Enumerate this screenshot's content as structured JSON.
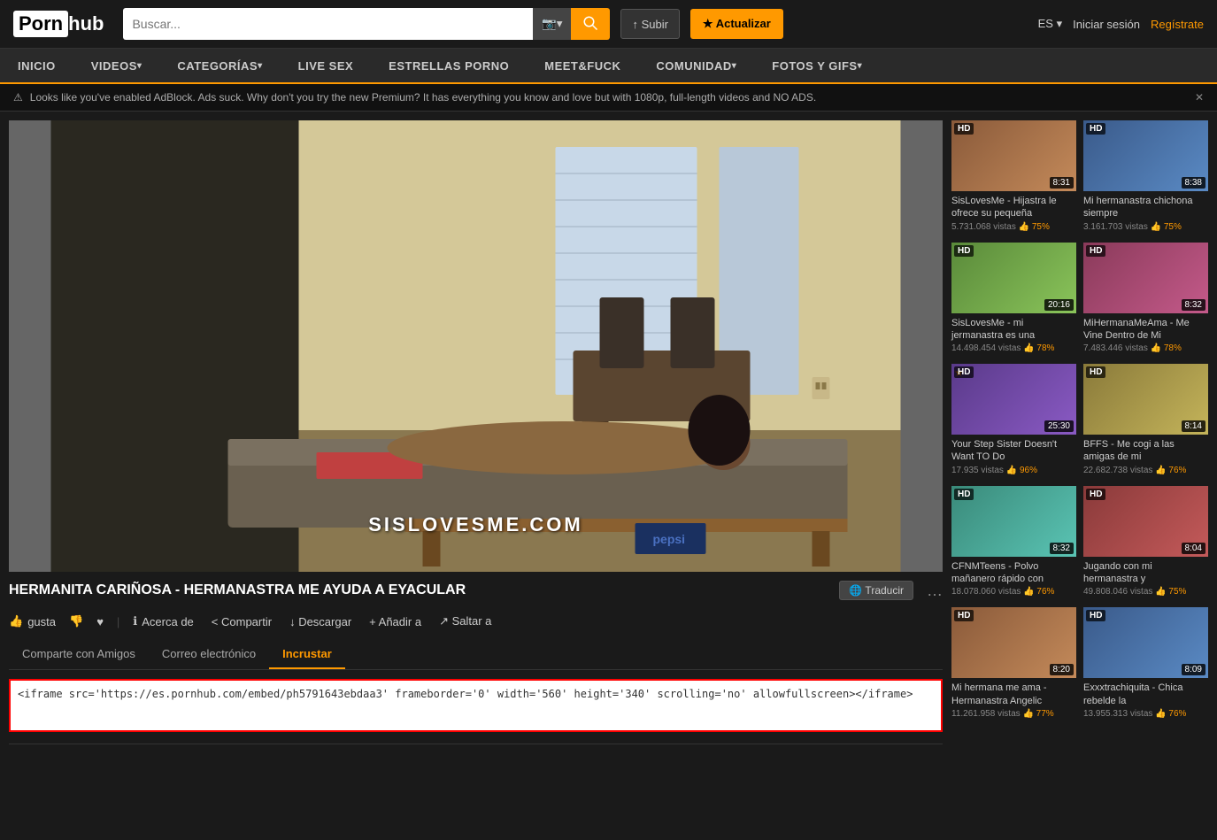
{
  "header": {
    "logo_black": "Porn",
    "logo_orange": "hub",
    "search_placeholder": "Buscar...",
    "upload_label": "↑ Subir",
    "premium_label": "★ Actualizar",
    "lang": "ES",
    "lang_arrow": "▾",
    "signin": "Iniciar sesión",
    "register": "Regístrate"
  },
  "nav": {
    "items": [
      {
        "label": "INICIO",
        "arrow": false
      },
      {
        "label": "VIDEOS",
        "arrow": true
      },
      {
        "label": "CATEGORÍAS",
        "arrow": true
      },
      {
        "label": "LIVE SEX",
        "arrow": false
      },
      {
        "label": "ESTRELLAS PORNO",
        "arrow": false
      },
      {
        "label": "MEET&FUCK",
        "arrow": false
      },
      {
        "label": "COMUNIDAD",
        "arrow": true
      },
      {
        "label": "FOTOS Y GIFS",
        "arrow": true
      }
    ]
  },
  "adblock": {
    "icon": "⚠",
    "text": "Looks like you've enabled AdBlock. Ads suck. Why don't you try the new Premium? It has everything you know and love but with 1080p, full-length videos and NO ADS.",
    "close": "✕"
  },
  "video": {
    "watermark": "SISLOVESME.COM",
    "title": "HERMANITA CARIÑOSA - HERMANASTRA ME AYUDA A EYACULAR",
    "translate_label": "🌐 Traducir",
    "more_icon": "…",
    "actions": {
      "like": "gusta",
      "dislike": "",
      "fav": "♥",
      "about": "Acerca de",
      "share": "< Compartir",
      "download": "↓ Descargar",
      "add": "+ Añadir a",
      "jump": "↗ Saltar a"
    },
    "tabs": [
      {
        "label": "Comparte con Amigos",
        "active": false
      },
      {
        "label": "Correo electrónico",
        "active": false
      },
      {
        "label": "Incrustar",
        "active": true
      }
    ],
    "embed_code": "<iframe src='https://es.pornhub.com/embed/ph5791643ebdaa3' frameborder='0' width='560' height='340' scrolling='no' allowfullscreen></iframe>"
  },
  "sidebar": {
    "videos": [
      {
        "title": "SisLovesMe - Hijastra le ofrece su pequeña",
        "views": "5.731.068 vistas",
        "rating": "75%",
        "duration": "8:31",
        "hd": true,
        "color": "thumb-color-1"
      },
      {
        "title": "Mi hermanastra chichona siempre",
        "views": "3.161.703 vistas",
        "rating": "75%",
        "duration": "8:38",
        "hd": true,
        "color": "thumb-color-2"
      },
      {
        "title": "SisLovesMe - mi jermanastra es una",
        "views": "14.498.454 vistas",
        "rating": "78%",
        "duration": "20:16",
        "hd": true,
        "color": "thumb-color-3"
      },
      {
        "title": "MiHermanaMeAma - Me Vine Dentro de Mi",
        "views": "7.483.446 vistas",
        "rating": "78%",
        "duration": "8:32",
        "hd": true,
        "color": "thumb-color-4"
      },
      {
        "title": "Your Step Sister Doesn't Want TO Do",
        "views": "17.935 vistas",
        "rating": "96%",
        "duration": "25:30",
        "hd": true,
        "star": true,
        "color": "thumb-color-5"
      },
      {
        "title": "BFFS - Me cogi a las amigas de mi",
        "views": "22.682.738 vistas",
        "rating": "76%",
        "duration": "8:14",
        "hd": true,
        "color": "thumb-color-6"
      },
      {
        "title": "CFNMTeens - Polvo mañanero rápido con",
        "views": "18.078.060 vistas",
        "rating": "76%",
        "duration": "8:32",
        "hd": true,
        "color": "thumb-color-7"
      },
      {
        "title": "Jugando con mi hermanastra y",
        "views": "49.808.046 vistas",
        "rating": "75%",
        "duration": "8:04",
        "hd": true,
        "color": "thumb-color-8"
      },
      {
        "title": "Mi hermana me ama - Hermanastra Angelic",
        "views": "11.261.958 vistas",
        "rating": "77%",
        "duration": "8:20",
        "hd": true,
        "color": "thumb-color-1"
      },
      {
        "title": "Exxxtrachiquita - Chica rebelde la",
        "views": "13.955.313 vistas",
        "rating": "76%",
        "duration": "8:09",
        "hd": true,
        "color": "thumb-color-2"
      }
    ]
  }
}
